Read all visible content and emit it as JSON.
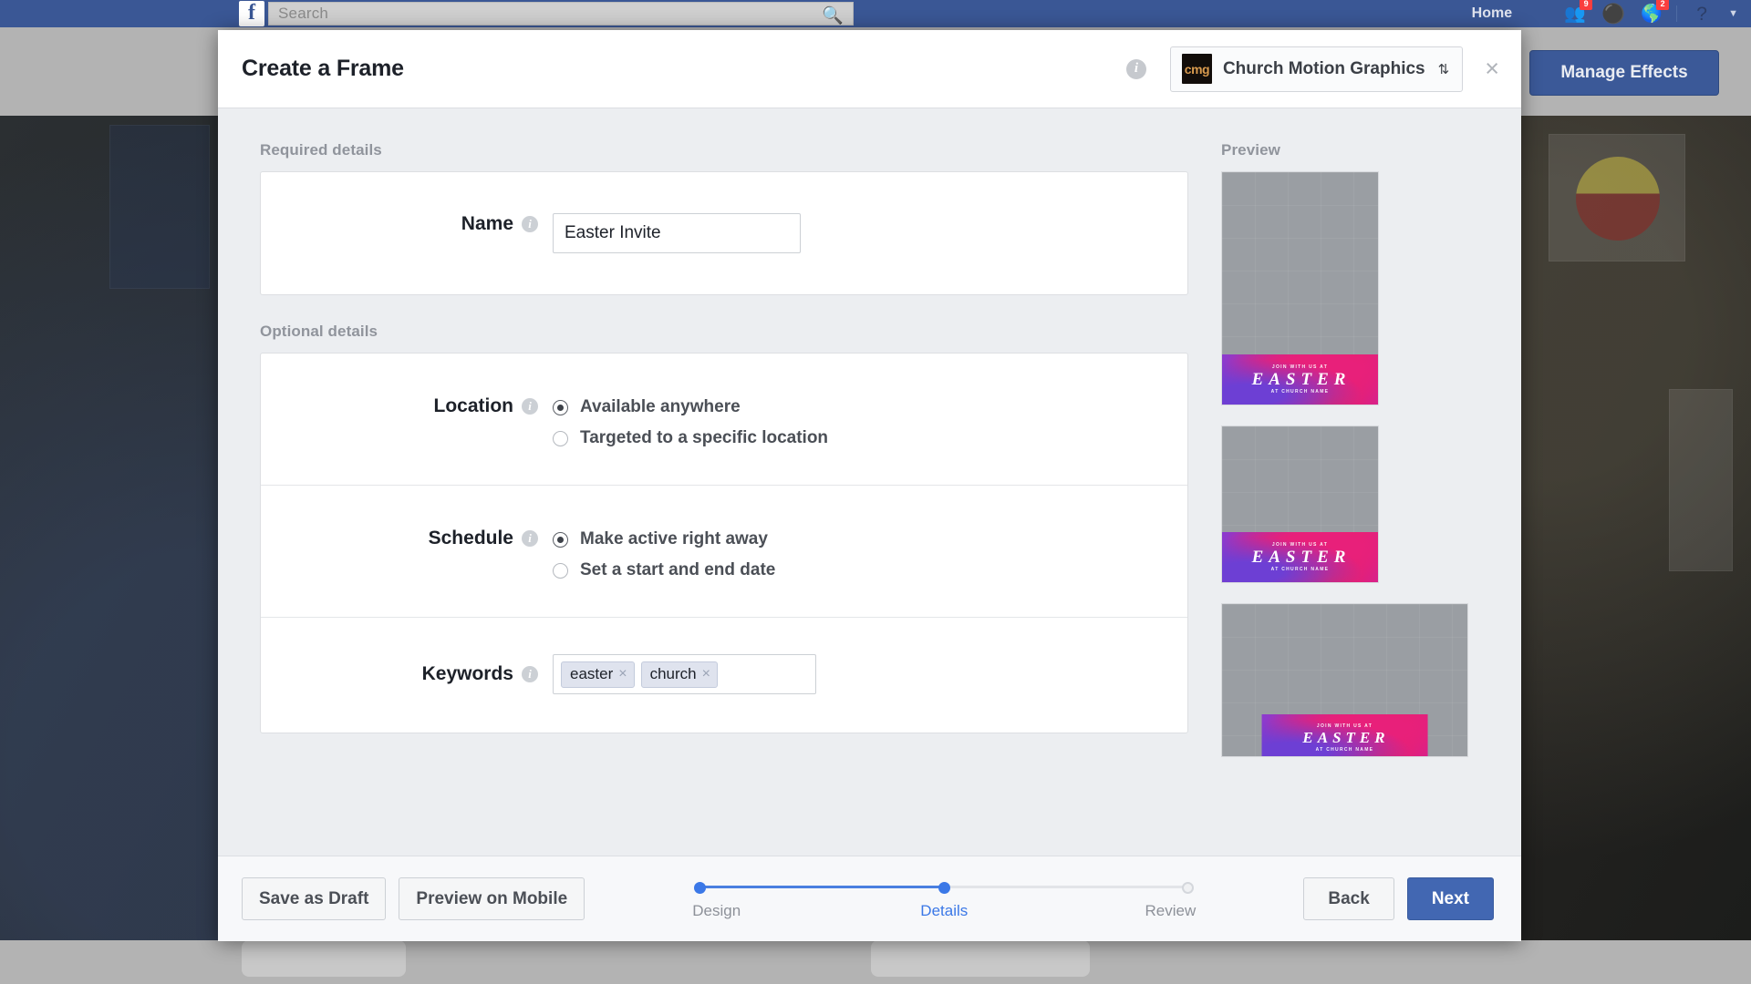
{
  "fb_bar": {
    "logo": "f",
    "search_placeholder": "Search",
    "search_icon": "search-icon",
    "home_label": "Home",
    "friend_requests_badge": "9",
    "notifications_badge": "2",
    "help_glyph": "?",
    "caret_glyph": "▼"
  },
  "page_header": {
    "manage_effects_label": "Manage Effects"
  },
  "modal": {
    "title": "Create a Frame",
    "info_glyph": "i",
    "page_selector": {
      "avatar_text": "cmg",
      "name": "Church Motion Graphics",
      "chevron": "⇅"
    },
    "close_glyph": "×"
  },
  "form": {
    "required_section_label": "Required details",
    "optional_section_label": "Optional details",
    "name": {
      "label": "Name",
      "value": "Easter Invite",
      "placeholder": ""
    },
    "location": {
      "label": "Location",
      "options": [
        {
          "label": "Available anywhere",
          "selected": true
        },
        {
          "label": "Targeted to a specific location",
          "selected": false
        }
      ]
    },
    "schedule": {
      "label": "Schedule",
      "options": [
        {
          "label": "Make active right away",
          "selected": true
        },
        {
          "label": "Set a start and end date",
          "selected": false
        }
      ]
    },
    "keywords": {
      "label": "Keywords",
      "tokens": [
        {
          "text": "easter",
          "remove_glyph": "×"
        },
        {
          "text": "church",
          "remove_glyph": "×"
        }
      ]
    }
  },
  "preview": {
    "label": "Preview",
    "frames": [
      {
        "aspect": "portrait",
        "overlay_top": "JOIN WITH US AT",
        "overlay_main": "EASTER",
        "overlay_bottom": "AT CHURCH NAME"
      },
      {
        "aspect": "square",
        "overlay_top": "JOIN WITH US AT",
        "overlay_main": "EASTER",
        "overlay_bottom": "AT CHURCH NAME"
      },
      {
        "aspect": "landscape",
        "overlay_top": "JOIN WITH US AT",
        "overlay_main": "EASTER",
        "overlay_bottom": "AT CHURCH NAME"
      }
    ]
  },
  "footer": {
    "save_draft_label": "Save as Draft",
    "preview_mobile_label": "Preview on Mobile",
    "back_label": "Back",
    "next_label": "Next",
    "steps": [
      {
        "label": "Design",
        "state": "complete"
      },
      {
        "label": "Details",
        "state": "current"
      },
      {
        "label": "Review",
        "state": "todo"
      }
    ]
  },
  "colors": {
    "facebook_blue": "#3a5795",
    "primary_button": "#4267b2",
    "stepper_active": "#3b78e7",
    "banner_pink": "#ef1f63",
    "banner_purple": "#8b3bd0"
  }
}
